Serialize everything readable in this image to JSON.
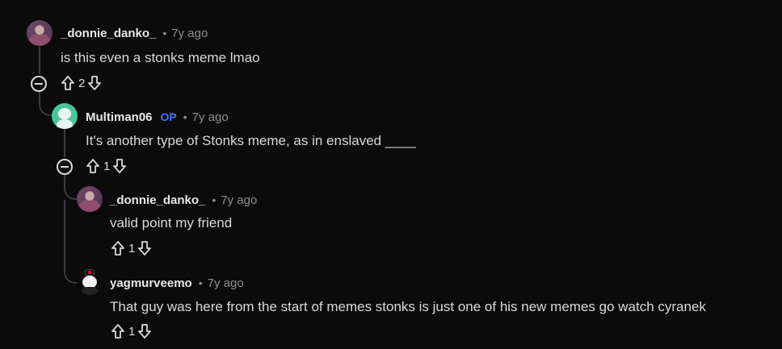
{
  "comments": [
    {
      "author": "_donnie_danko_",
      "separator": "•",
      "time": "7y ago",
      "text": "is this even a stonks meme lmao",
      "votes": "2",
      "avatar": "donnie-avatar"
    },
    {
      "author": "Multiman06",
      "op": "OP",
      "separator": "•",
      "time": "7y ago",
      "text": "It's another type of Stonks meme, as in enslaved ____",
      "votes": "1",
      "avatar": "snoo-avatar"
    },
    {
      "author": "_donnie_danko_",
      "separator": "•",
      "time": "7y ago",
      "text": "valid point my friend",
      "votes": "1",
      "avatar": "donnie-avatar"
    },
    {
      "author": "yagmurveemo",
      "separator": "•",
      "time": "7y ago",
      "text": "That guy was here from the start of memes stonks is just one of his new memes go watch cyranek",
      "votes": "1",
      "avatar": "snoo-hat-avatar"
    }
  ],
  "colors": {
    "background": "#0b0b0b",
    "op_badge": "#3c7bf5",
    "thread_line": "#3a3d3f"
  }
}
